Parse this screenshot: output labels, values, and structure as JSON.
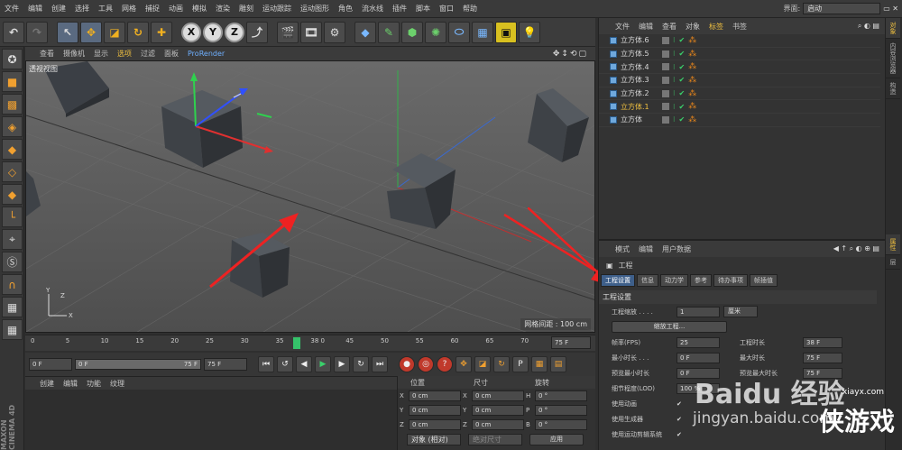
{
  "menu": [
    "文件",
    "编辑",
    "创建",
    "选择",
    "工具",
    "网格",
    "捕捉",
    "动画",
    "模拟",
    "渲染",
    "雕刻",
    "运动跟踪",
    "运动图形",
    "角色",
    "流水线",
    "插件",
    "脚本",
    "窗口",
    "帮助"
  ],
  "interface_label": "界面:",
  "interface_value": "启动",
  "viewport": {
    "menu": [
      "查看",
      "摄像机",
      "显示",
      "选项",
      "过滤",
      "面板",
      "ProRender"
    ],
    "active_menu": "选项",
    "label": "透视视图",
    "grid_label": "网格间距 : 100 cm"
  },
  "timeline": {
    "ticks": [
      "0",
      "5",
      "10",
      "15",
      "20",
      "25",
      "30",
      "35",
      "38 0",
      "45",
      "50",
      "55",
      "60",
      "65",
      "70",
      "75"
    ],
    "current_frame": 38,
    "end_frame_field": "75 F"
  },
  "playbar": {
    "start": "0 F",
    "slider_left": "0 F",
    "slider_right": "75 F",
    "end": "75 F"
  },
  "material_menu": [
    "创建",
    "编辑",
    "功能",
    "纹理"
  ],
  "coords": {
    "headers": [
      "位置",
      "尺寸",
      "旋转"
    ],
    "rows": [
      {
        "a": "X",
        "pos": "0 cm",
        "b": "X",
        "size": "0 cm",
        "c": "H",
        "rot": "0 °"
      },
      {
        "a": "Y",
        "pos": "0 cm",
        "b": "Y",
        "size": "0 cm",
        "c": "P",
        "rot": "0 °"
      },
      {
        "a": "Z",
        "pos": "0 cm",
        "b": "Z",
        "size": "0 cm",
        "c": "B",
        "rot": "0 °"
      }
    ],
    "mode": "对象 (相对)",
    "size_mode": "绝对尺寸",
    "apply": "应用"
  },
  "object_manager": {
    "menu": [
      "文件",
      "编辑",
      "查看",
      "对象",
      "标签",
      "书签"
    ],
    "active_menu": "标签",
    "objects": [
      {
        "name": "立方体.6",
        "selected": false
      },
      {
        "name": "立方体.5",
        "selected": false
      },
      {
        "name": "立方体.4",
        "selected": false
      },
      {
        "name": "立方体.3",
        "selected": false
      },
      {
        "name": "立方体.2",
        "selected": false
      },
      {
        "name": "立方体.1",
        "selected": true
      },
      {
        "name": "立方体",
        "selected": false
      }
    ]
  },
  "attributes": {
    "menu": [
      "模式",
      "编辑",
      "用户数据"
    ],
    "title": "工程",
    "tabs": [
      "工程设置",
      "信息",
      "动力学",
      "参考",
      "待办事项",
      "帧插值"
    ],
    "active_tab": "工程设置",
    "section": "工程设置",
    "scale_label": "工程缩放 . . . .",
    "scale_value": "1",
    "scale_unit": "厘米",
    "scale_button": "缩放工程...",
    "rows": [
      {
        "l1": "帧率(FPS)",
        "v1": "25",
        "l2": "工程时长",
        "v2": "38 F"
      },
      {
        "l1": "最小时长 . . .",
        "v1": "0 F",
        "l2": "最大时长",
        "v2": "75 F"
      },
      {
        "l1": "预览最小时长",
        "v1": "0 F",
        "l2": "预览最大时长",
        "v2": "75 F"
      }
    ],
    "lod_label": "细节程度(LOD)",
    "lod_value": "100 %",
    "checks": [
      "使用动画",
      "使用生成器",
      "使用运动剪辑系统"
    ]
  },
  "side_tabs": [
    "对象",
    "内容浏览器",
    "构造",
    "属性",
    "层"
  ],
  "watermark": {
    "line1": "Baidu 经验",
    "line2": "jingyan.baidu.com",
    "site": "xiayx.com",
    "logo": "侠游戏"
  },
  "brand": "MAXON CINEMA 4D"
}
